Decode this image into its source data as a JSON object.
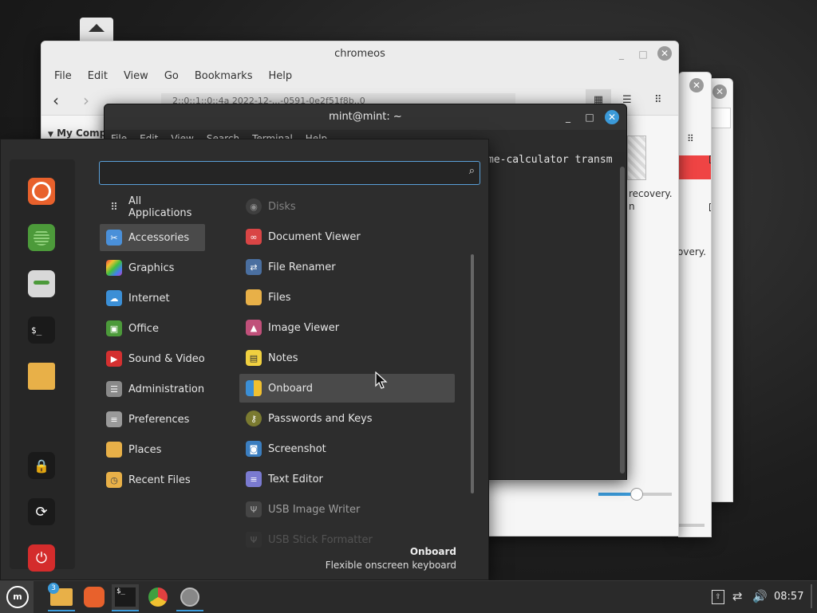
{
  "file_manager": {
    "title": "chromeos",
    "menu": [
      "File",
      "Edit",
      "View",
      "Go",
      "Bookmarks",
      "Help"
    ],
    "sidebar_heading": "My Comp",
    "path": "2::0::1::0::4a 2022-12-...-0591-0e2f51f8b..0"
  },
  "right_windows": {
    "text1": "recovery.",
    "text2": "n",
    "text3": "overy."
  },
  "terminal": {
    "title": "mint@mint: ~",
    "menu": [
      "File",
      "Edit",
      "View",
      "Search",
      "Terminal",
      "Help"
    ],
    "visible_text": "me-calculator transm"
  },
  "menu": {
    "search_value": "",
    "categories": [
      {
        "label": "All Applications",
        "color": "#2d2d2d"
      },
      {
        "label": "Accessories",
        "color": "#4a90d9"
      },
      {
        "label": "Graphics",
        "color": "#c05cc0"
      },
      {
        "label": "Internet",
        "color": "#3b8fd6"
      },
      {
        "label": "Office",
        "color": "#4c9a3a"
      },
      {
        "label": "Sound & Video",
        "color": "#d43030"
      },
      {
        "label": "Administration",
        "color": "#6a6a6a"
      },
      {
        "label": "Preferences",
        "color": "#7a7a7a"
      },
      {
        "label": "Places",
        "color": "#e8b048"
      },
      {
        "label": "Recent Files",
        "color": "#e8b048"
      }
    ],
    "apps": [
      {
        "label": "Disks",
        "color": "#555555"
      },
      {
        "label": "Document Viewer",
        "color": "#d94545"
      },
      {
        "label": "File Renamer",
        "color": "#4a6fa0"
      },
      {
        "label": "Files",
        "color": "#e8b048"
      },
      {
        "label": "Image Viewer",
        "color": "#c0507a"
      },
      {
        "label": "Notes",
        "color": "#f0d040"
      },
      {
        "label": "Onboard",
        "color": "#3b8fd6"
      },
      {
        "label": "Passwords and Keys",
        "color": "#7a7a30"
      },
      {
        "label": "Screenshot",
        "color": "#3b7ec0"
      },
      {
        "label": "Text Editor",
        "color": "#7a7ad0"
      },
      {
        "label": "USB Image Writer",
        "color": "#555555"
      },
      {
        "label": "USB Stick Formatter",
        "color": "#444444"
      }
    ],
    "description_title": "Onboard",
    "description_text": "Flexible onscreen keyboard"
  },
  "panel": {
    "badge_count": "3",
    "clock": "08:57"
  },
  "colors": {
    "accent": "#5aa0d8",
    "close_blue": "#3b9ad9"
  }
}
